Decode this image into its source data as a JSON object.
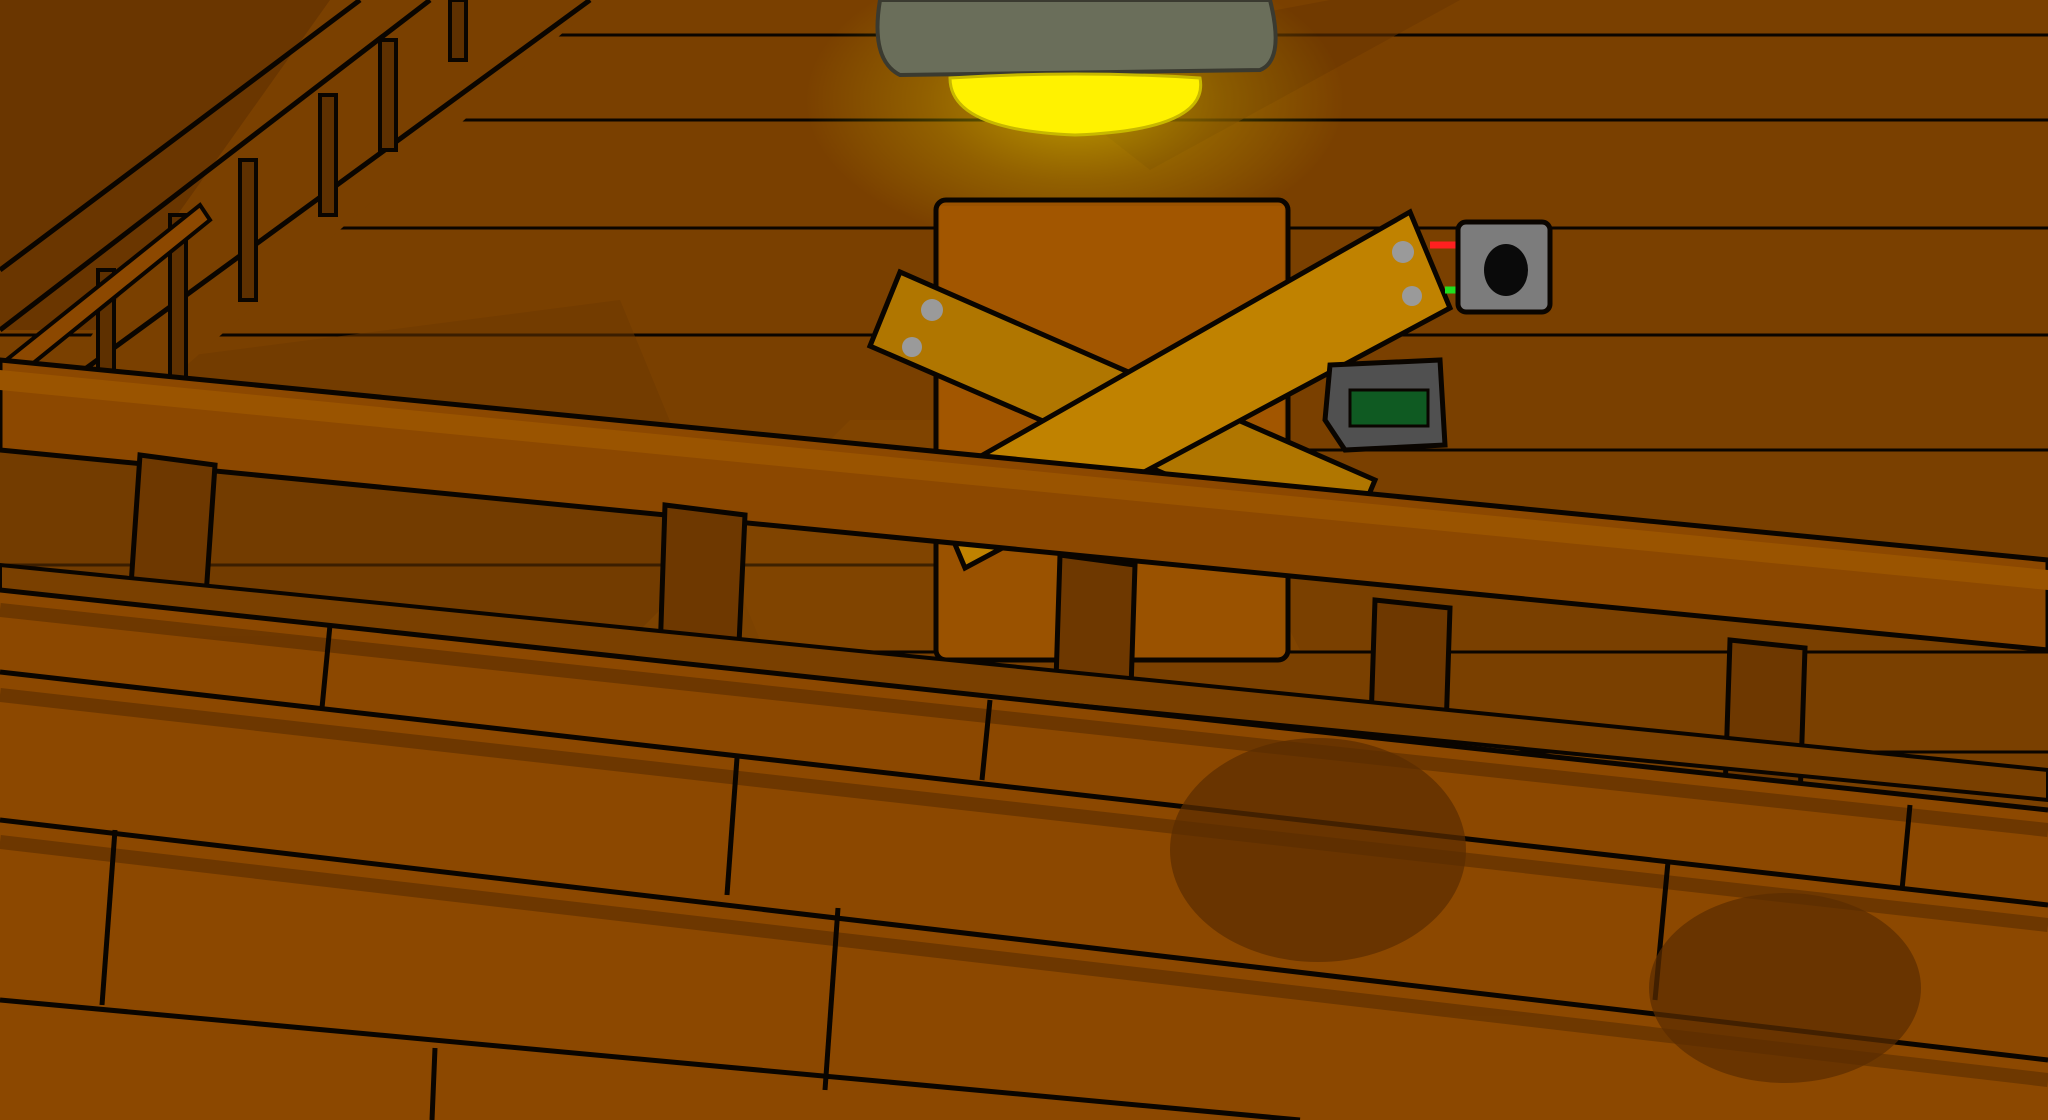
{
  "scene": {
    "title": "",
    "colors": {
      "wall": "#7a4000",
      "wall_plank": "#844600",
      "wall_line": "#0a0500",
      "shadow": "#5a2e00",
      "deck": "#8c4800",
      "deck_dark": "#6a3600",
      "deck_highlight": "#9a5400",
      "board": "#c08200",
      "board_alt": "#b07600",
      "bolt": "#9a9a9a",
      "lamp_shade": "#6a6e5a",
      "lamp_glow": "#fff200",
      "keypad_case": "#505050",
      "keypad_screen": "#0f5a22",
      "socket_case": "#7c7c7c",
      "wire_red": "#ff2020",
      "wire_green": "#20e020",
      "stain": "#5a2c00"
    },
    "icons": {
      "lamp": "ceiling-lamp-icon",
      "keypad": "keypad-icon",
      "socket": "wall-socket-icon",
      "wires": "wires-icon",
      "boarded_door": "boarded-door-icon",
      "stairs": "staircase-icon"
    }
  }
}
